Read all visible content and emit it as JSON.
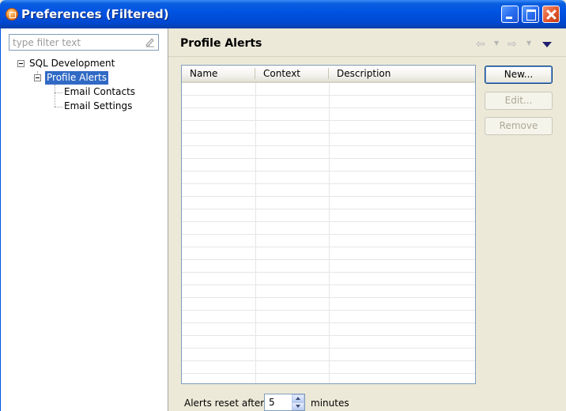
{
  "window": {
    "title": "Preferences (Filtered)"
  },
  "sidebar": {
    "filter_placeholder": "type filter text",
    "tree": [
      {
        "label": "SQL Development",
        "expanded": true
      },
      {
        "label": "Profile Alerts",
        "expanded": true,
        "selected": true
      },
      {
        "label": "Email Contacts"
      },
      {
        "label": "Email Settings"
      }
    ]
  },
  "page": {
    "title": "Profile Alerts",
    "table": {
      "columns": [
        "Name",
        "Context",
        "Description"
      ],
      "rows": []
    },
    "buttons": {
      "new": "New...",
      "edit": "Edit...",
      "remove": "Remove"
    },
    "reset": {
      "label": "Alerts reset after",
      "value": "5",
      "suffix": "minutes"
    }
  },
  "icons": {
    "back": "back-arrow-icon",
    "forward": "forward-arrow-icon",
    "view_menu": "view-menu-icon",
    "clear_filter": "clear-filter-icon"
  },
  "colors": {
    "titlebar": "#0054E3",
    "selection": "#316AC5",
    "dialog_bg": "#ECE9D8"
  }
}
